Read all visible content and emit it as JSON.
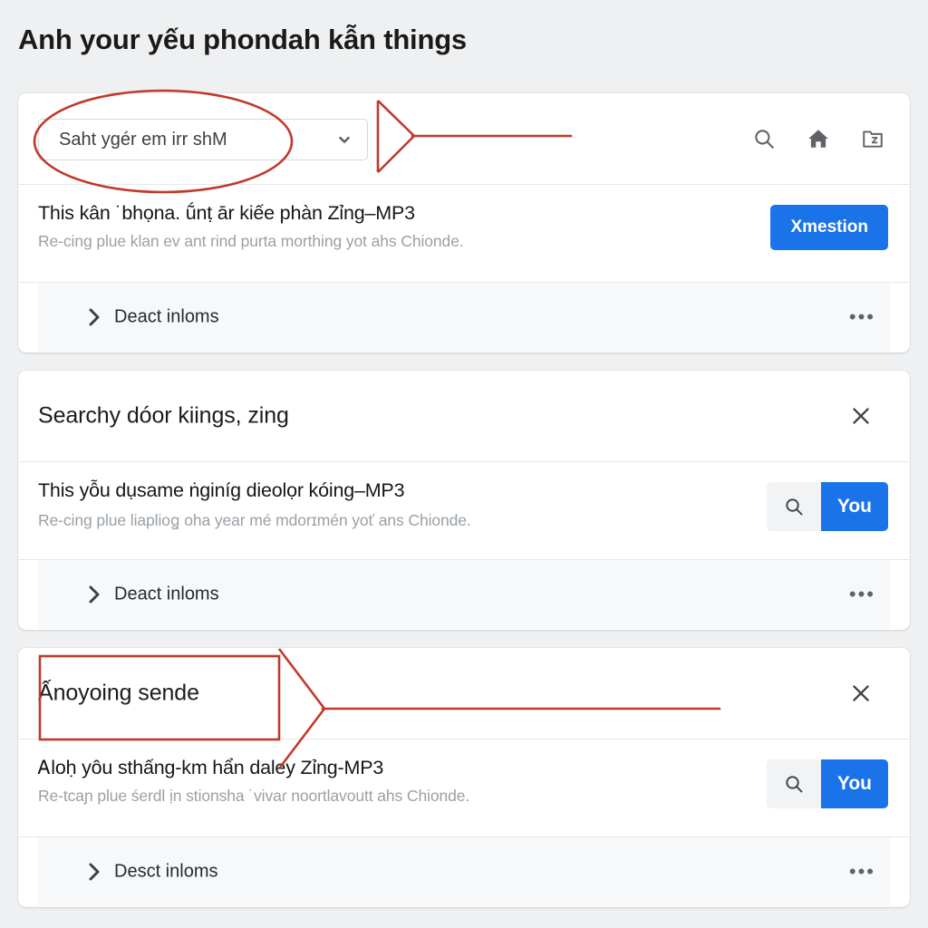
{
  "page": {
    "title": "Anh your yếu phondah kẫn things",
    "background_color": "#eef0f2",
    "accent_color": "#1a73e8",
    "annotation_color": "#c0392b"
  },
  "cards": [
    {
      "header": {
        "type": "select-and-icons",
        "select_value": "Saht ygér em irr shM",
        "caret_icon": "chevron-down-icon",
        "icons": [
          {
            "name": "search-icon",
            "label": "Search"
          },
          {
            "name": "home-icon",
            "label": "Home"
          },
          {
            "name": "archive-folder-icon",
            "label": "Archive"
          }
        ]
      },
      "body": {
        "title": "This kân ˙bhọna. ṹnṭ ār kiếe phàn Zỉng–MP3",
        "subtitle": "Re-cing plue klan ev ant rind purta morthing yot ahs Chionde.",
        "action": {
          "kind": "primary",
          "label": "Xmestion"
        }
      },
      "foot": {
        "chevron_icon": "chevron-right-icon",
        "label": "Deact inloms",
        "more_icon": "overflow-dots-icon",
        "more_label": "•••"
      }
    },
    {
      "header": {
        "type": "title-and-close",
        "title": "Searchy dóor kiings, zing",
        "close_icon": "close-icon"
      },
      "body": {
        "title": "This yỗu dụsame ṅginíg dieolọr kóing–MP3",
        "subtitle": "Re-cing plue liaplioꬶ oha year mé mdorɪmén yoť ans Chionde.",
        "action": {
          "kind": "split",
          "icon": "search-icon",
          "label": "You"
        }
      },
      "foot": {
        "chevron_icon": "chevron-right-icon",
        "label": "Deact inloms",
        "more_icon": "overflow-dots-icon",
        "more_label": "•••"
      }
    },
    {
      "header": {
        "type": "title-and-close",
        "title": "Ấnoyoing sende",
        "close_icon": "close-icon"
      },
      "body": {
        "title": "Ꭺloḥ yôu sthấng-km hẩn daley Zỉng-MP3",
        "subtitle": "Re-tcaɲ plue śerdl ịn stionsha ˙vivaɾ noortlavoutt ahs Chionde.",
        "action": {
          "kind": "split",
          "icon": "search-icon",
          "label": "You"
        }
      },
      "foot": {
        "chevron_icon": "chevron-right-icon",
        "label": "Desct inloms",
        "more_icon": "overflow-dots-icon",
        "more_label": "•••"
      }
    }
  ],
  "annotations": [
    {
      "name": "ellipse-highlight-select",
      "shape": "ellipse"
    },
    {
      "name": "callout-arrow-select",
      "shape": "arrow-left"
    },
    {
      "name": "rectangle-highlight-title",
      "shape": "rectangle"
    },
    {
      "name": "callout-arrow-title",
      "shape": "arrow-left"
    }
  ]
}
